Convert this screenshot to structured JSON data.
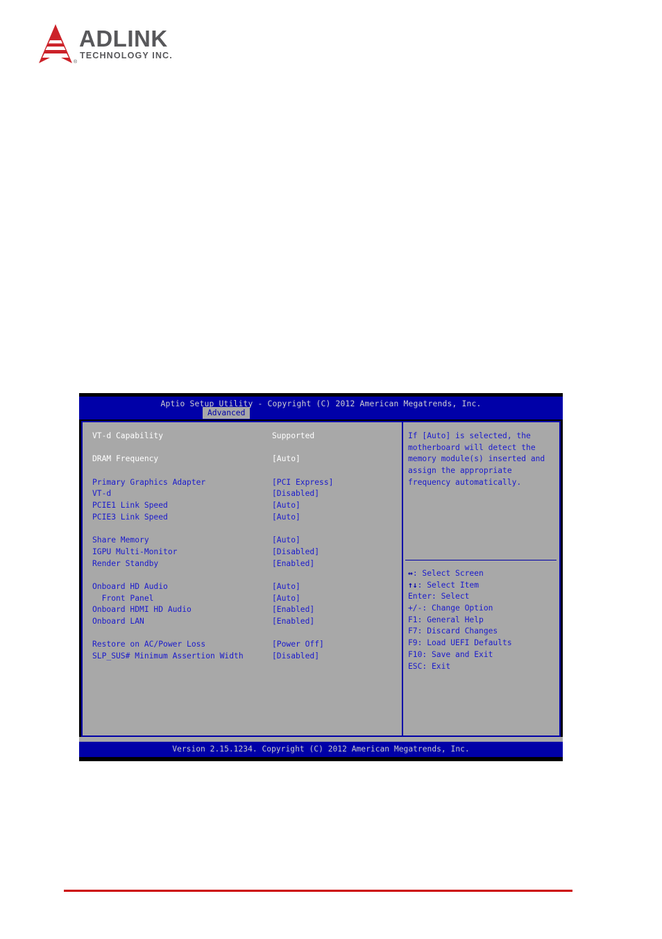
{
  "brand": {
    "name": "ADLINK",
    "tagline": "TECHNOLOGY INC.",
    "registered": "®",
    "logo_color": "#cc2229",
    "text_color": "#58585b"
  },
  "bios": {
    "title": "Aptio Setup Utility - Copyright (C) 2012 American Megatrends, Inc.",
    "active_tab": "Advanced",
    "footer": "Version 2.15.1234. Copyright (C) 2012 American Megatrends, Inc.",
    "colors": {
      "background": "#a8a8a8",
      "header": "#0000a8",
      "item_blue": "#1a1acc",
      "item_white": "#ffffff"
    },
    "settings": [
      {
        "label": "VT-d Capability",
        "value": "Supported",
        "style": "white",
        "indent": false
      },
      {
        "label": "",
        "value": "",
        "style": "spacer",
        "indent": false
      },
      {
        "label": "DRAM Frequency",
        "value": "[Auto]",
        "style": "white",
        "indent": false
      },
      {
        "label": "",
        "value": "",
        "style": "spacer",
        "indent": false
      },
      {
        "label": "Primary Graphics Adapter",
        "value": "[PCI Express]",
        "style": "blue",
        "indent": false
      },
      {
        "label": "VT-d",
        "value": "[Disabled]",
        "style": "blue",
        "indent": false
      },
      {
        "label": "PCIE1 Link Speed",
        "value": "[Auto]",
        "style": "blue",
        "indent": false
      },
      {
        "label": "PCIE3 Link Speed",
        "value": "[Auto]",
        "style": "blue",
        "indent": false
      },
      {
        "label": "",
        "value": "",
        "style": "spacer",
        "indent": false
      },
      {
        "label": "Share Memory",
        "value": "[Auto]",
        "style": "blue",
        "indent": false
      },
      {
        "label": "IGPU Multi-Monitor",
        "value": "[Disabled]",
        "style": "blue",
        "indent": false
      },
      {
        "label": "Render Standby",
        "value": "[Enabled]",
        "style": "blue",
        "indent": false
      },
      {
        "label": "",
        "value": "",
        "style": "spacer",
        "indent": false
      },
      {
        "label": "Onboard HD Audio",
        "value": "[Auto]",
        "style": "blue",
        "indent": false
      },
      {
        "label": "  Front Panel",
        "value": "[Auto]",
        "style": "blue",
        "indent": true
      },
      {
        "label": "Onboard HDMI HD Audio",
        "value": "[Enabled]",
        "style": "blue",
        "indent": false
      },
      {
        "label": "Onboard LAN",
        "value": "[Enabled]",
        "style": "blue",
        "indent": false
      },
      {
        "label": "",
        "value": "",
        "style": "spacer",
        "indent": false
      },
      {
        "label": "Restore on AC/Power Loss",
        "value": "[Power Off]",
        "style": "blue",
        "indent": false
      },
      {
        "label": "SLP_SUS# Minimum Assertion Width",
        "value": "[Disabled]",
        "style": "blue",
        "indent": false
      }
    ],
    "help": {
      "text": "If [Auto] is selected, the motherboard will detect the memory module(s) inserted and assign the appropriate frequency automatically."
    },
    "keys": [
      {
        "glyph": "↔",
        "label": ": Select Screen"
      },
      {
        "glyph": "↑↓",
        "label": ": Select Item"
      },
      {
        "glyph": "",
        "label": "Enter: Select"
      },
      {
        "glyph": "",
        "label": "+/-: Change Option"
      },
      {
        "glyph": "",
        "label": "F1: General Help"
      },
      {
        "glyph": "",
        "label": "F7: Discard Changes"
      },
      {
        "glyph": "",
        "label": "F9: Load UEFI Defaults"
      },
      {
        "glyph": "",
        "label": "F10: Save and Exit"
      },
      {
        "glyph": "",
        "label": "ESC: Exit"
      }
    ]
  }
}
